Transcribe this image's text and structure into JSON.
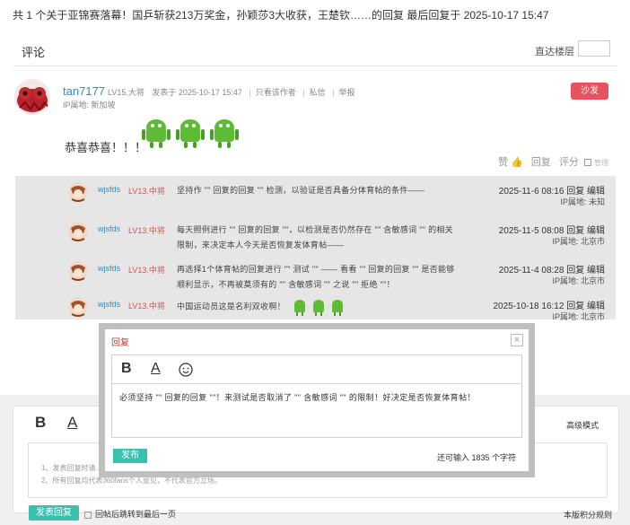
{
  "topbar": {
    "text": "共 1 个关于亚锦赛落幕！国乒斩获213万奖金，孙颖莎3大收获，王楚钦……的回复 最后回复于 2025-10-17 15:47"
  },
  "section": {
    "title": "评论",
    "jump_label": "直达楼层"
  },
  "post": {
    "username": "tan7177",
    "level": "LV15.大将",
    "posted": "发表于 2025-10-17 15:47",
    "only_author": "只看该作者",
    "message": "私信",
    "report": "举报",
    "ip": "IP属地: 新加坡",
    "badge": "沙发",
    "text": "恭喜恭喜！！！",
    "actions": {
      "like": "赞",
      "reply": "回复",
      "rate": "评分",
      "manage": "管理"
    }
  },
  "replies": [
    {
      "user": "wjsfds",
      "level": "LV13.中将",
      "text": "坚持作 \"\" 回复的回复 \"\" 检测，以验证是否具备分体育帖的条件——",
      "date": "2025-11-6 08:16",
      "actions": "回复 编辑",
      "ip": "IP属地: 未知"
    },
    {
      "user": "wjsfds",
      "level": "LV13.中将",
      "text": "每天照例进行 \"\" 回复的回复 \"\"，以检测是否仍然存在 \"\" 含敏感词 \"\" 的相关限制，来决定本人今天是否恢复发体育帖——",
      "date": "2025-11-5 08:08",
      "actions": "回复 编辑",
      "ip": "IP属地: 北京市"
    },
    {
      "user": "wjsfds",
      "level": "LV13.中将",
      "text": "再选择1个体育帖的回复进行 \"\" 测试 \"\" —— 看看 \"\" 回复的回复 \"\" 是否能够顺利显示，不再被莫须有的 \"\" 含敏感词 \"\" 之说 \"\" 拒绝 \"\"！",
      "date": "2025-11-4 08:28",
      "actions": "回复 编辑",
      "ip": "IP属地: 北京市"
    },
    {
      "user": "wjsfds",
      "level": "LV13.中将",
      "text": "中国运动员这是名利双收啊！",
      "date": "2025-10-18 16:12",
      "actions": "回复 编辑",
      "ip": "IP属地: 北京市"
    }
  ],
  "editor": {
    "advanced": "高级模式",
    "hint1": "1、发表回复时请…",
    "hint2": "2、所有回复均代表360fans个人意见，不代表官方立场。",
    "submit": "发表回复",
    "jump_last": "回帖后跳转到最后一页",
    "rules": "本版积分规则"
  },
  "modal": {
    "title": "回复",
    "close": "×",
    "text": "必须坚持 \"\" 回复的回复 \"\"！来测试是否取消了 \"\" 含敏感词 \"\" 的限制！好决定是否恢复体育帖！",
    "submit": "发布",
    "count": "还可输入 1835 个字符"
  },
  "colors": {
    "accent": "#3bbfae",
    "badge": "#e8525f",
    "link": "#2a8ccf",
    "level": "#d9534f"
  }
}
